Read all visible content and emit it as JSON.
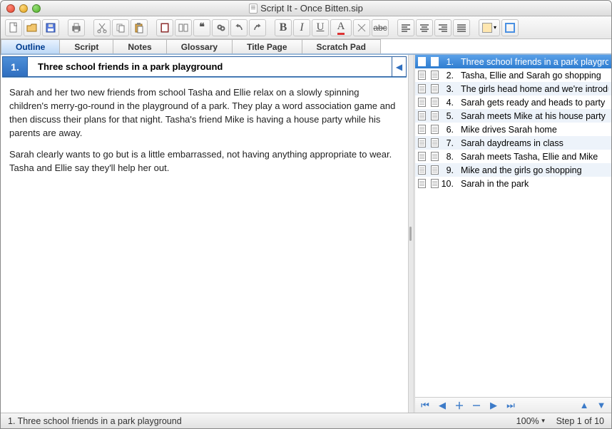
{
  "window": {
    "title": "Script It - Once Bitten.sip"
  },
  "tabs": [
    {
      "label": "Outline",
      "active": true
    },
    {
      "label": "Script",
      "active": false
    },
    {
      "label": "Notes",
      "active": false
    },
    {
      "label": "Glossary",
      "active": false
    },
    {
      "label": "Title Page",
      "active": false
    },
    {
      "label": "Scratch Pad",
      "active": false
    }
  ],
  "card": {
    "number": "1.",
    "title": "Three school friends in a park playground",
    "paragraphs": [
      "Sarah and her two new friends from school Tasha and Ellie relax on a slowly spinning children's merry-go-round in the playground of a park.  They play a word association game and then discuss their plans for that night.  Tasha's friend Mike is having a house party while his parents are away.",
      "Sarah clearly wants to go but is a little embarrassed, not having anything appropriate to wear.  Tasha and Ellie say they'll help her out."
    ]
  },
  "scenes": [
    {
      "num": "1.",
      "title": "Three school friends in a park playground",
      "odd": false,
      "sel": true
    },
    {
      "num": "2.",
      "title": "Tasha, Ellie and Sarah go shopping",
      "odd": false,
      "sel": false
    },
    {
      "num": "3.",
      "title": "The girls head home and we're introduced",
      "odd": true,
      "sel": false
    },
    {
      "num": "4.",
      "title": "Sarah gets ready and heads to party",
      "odd": false,
      "sel": false
    },
    {
      "num": "5.",
      "title": "Sarah meets Mike at his house party",
      "odd": true,
      "sel": false
    },
    {
      "num": "6.",
      "title": "Mike drives Sarah home",
      "odd": false,
      "sel": false
    },
    {
      "num": "7.",
      "title": "Sarah daydreams in class",
      "odd": true,
      "sel": false
    },
    {
      "num": "8.",
      "title": "Sarah meets Tasha, Ellie and Mike",
      "odd": false,
      "sel": false
    },
    {
      "num": "9.",
      "title": "Mike and the girls go shopping",
      "odd": true,
      "sel": false
    },
    {
      "num": "10.",
      "title": "Sarah in the park",
      "odd": false,
      "sel": false
    }
  ],
  "status": {
    "text": "1.  Three school friends in a park playground",
    "zoom": "100%",
    "step": "Step 1 of 10"
  }
}
